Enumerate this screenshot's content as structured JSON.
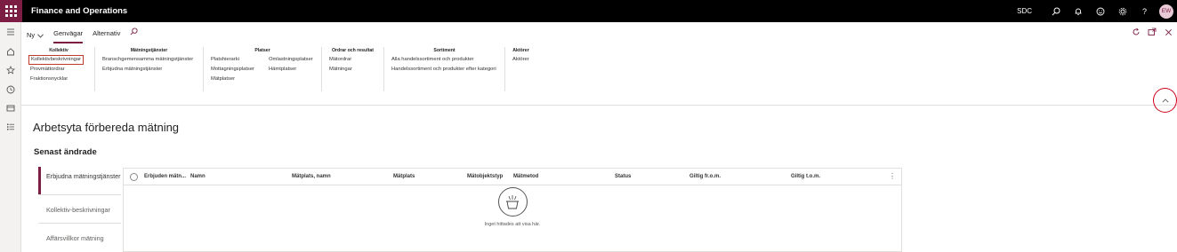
{
  "app": {
    "title": "Finance and Operations",
    "company": "SDC",
    "user_initials": "EW"
  },
  "tabs": {
    "new_label": "Ny",
    "items": [
      "Genvägar",
      "Alternativ"
    ]
  },
  "groups": [
    {
      "header": "Kollektiv",
      "columns": [
        [
          "Kollektivbeskrivningar",
          "Provmättordrar",
          "Fraktionsnycklar"
        ]
      ]
    },
    {
      "header": "Mätningstjänster",
      "columns": [
        [
          "Branschgemensamma mätningstjänster",
          "Erbjudna mätningstjänster"
        ]
      ]
    },
    {
      "header": "Platser",
      "columns": [
        [
          "Platshierarki",
          "Mottagningsplatser",
          "Mätplatser"
        ],
        [
          "Omlastningsplatser",
          "Hämtplatser"
        ]
      ]
    },
    {
      "header": "Ordrar och resultat",
      "columns": [
        [
          "Mätordrar",
          "Mätningar"
        ]
      ]
    },
    {
      "header": "Sortiment",
      "columns": [
        [
          "Alla handelssortiment och produkter",
          "Handelssortiment och produkter efter kategori"
        ]
      ]
    },
    {
      "header": "Aktörer",
      "columns": [
        [
          "Aktörer"
        ]
      ]
    }
  ],
  "workspace": {
    "title": "Arbetsyta förbereda mätning",
    "section": "Senast ändrade",
    "vtabs": [
      "Erbjudna mätningstjänster",
      "Kollektiv-beskrivningar",
      "Affärsvillkor mätning"
    ],
    "grid": {
      "columns": [
        "Erbjuden mätn...",
        "Namn",
        "Mätplats, namn",
        "Mätplats",
        "Mätobjektstyp",
        "Mätmetod",
        "Status",
        "Giltig fr.o.m.",
        "Giltig t.o.m."
      ],
      "empty_message": "Inget hittades att visa här."
    }
  },
  "colors": {
    "brand": "#7c1e44",
    "topbar": "#000000",
    "highlight": "#d0021b"
  }
}
